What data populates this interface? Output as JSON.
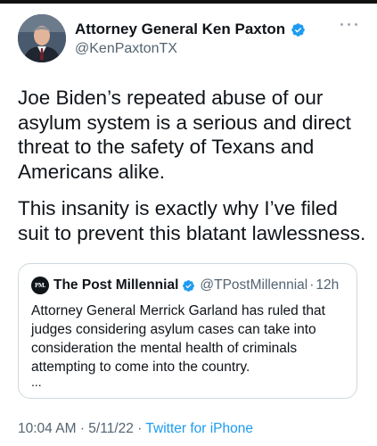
{
  "tweet": {
    "author_name": "Attorney General Ken Paxton",
    "author_handle": "@KenPaxtonTX",
    "paragraph_1": "Joe Biden’s repeated abuse of our asylum system is a serious and direct threat to the safety of Texans and Americans alike.",
    "paragraph_2": "This insanity is exactly why I’ve filed suit to prevent this blatant lawlessness.",
    "time": "10:04 AM",
    "date": "5/11/22",
    "separator": "·",
    "source": "Twitter for iPhone"
  },
  "quoted_tweet": {
    "avatar_text": "PM.",
    "author_name": "The Post Millennial",
    "author_handle": "@TPostMillennial",
    "separator": "·",
    "age": "12h",
    "text": "Attorney General Merrick Garland has ruled that judges considering asylum cases can take into consideration the mental health of criminals attempting to come into the country.",
    "ellipsis": "..."
  },
  "icons": {
    "verified": "verified-badge-icon",
    "more": "more-options-icon"
  },
  "colors": {
    "verified_blue": "#1d9bf0",
    "secondary_text": "#536471",
    "primary_text": "#0f1419",
    "border": "#cfd9de"
  }
}
